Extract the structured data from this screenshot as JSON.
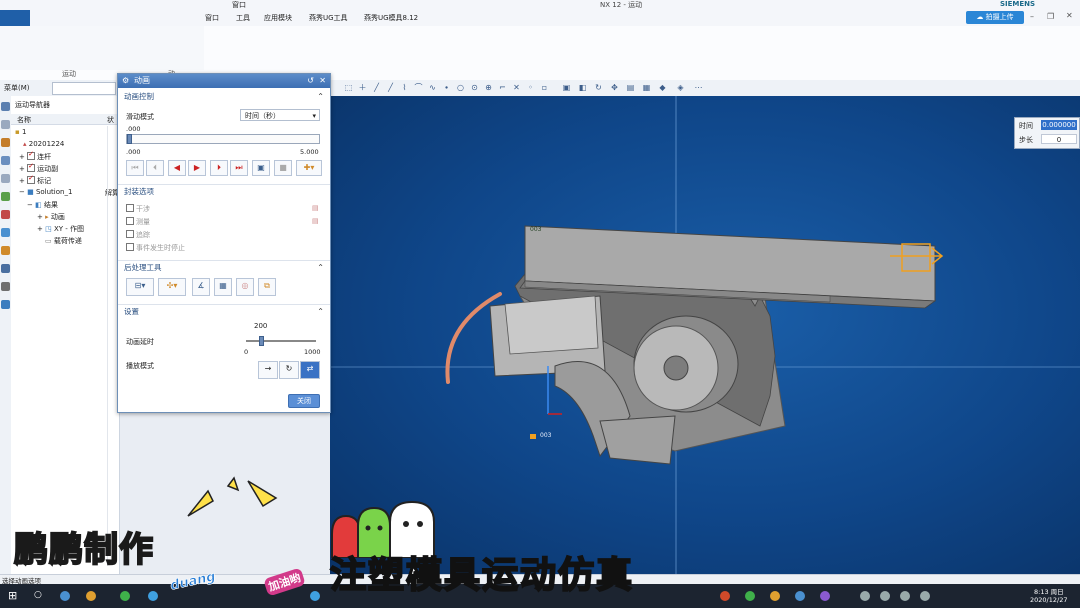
{
  "window": {
    "title": "NX 12 - 运动",
    "brand": "SIEMENS",
    "window_menu": "窗口"
  },
  "menu": {
    "items": [
      "窗口",
      "工具",
      "应用模块",
      "燕秀UG工具",
      "燕秀UG模具8.12"
    ]
  },
  "ribbon": {
    "group_labels": [
      "运动",
      "动"
    ],
    "upload_button": "拍摄上传"
  },
  "toolbar": {
    "view_dropdown": "菜单(M)"
  },
  "navigator": {
    "title": "运动导航器",
    "col_name": "名称",
    "col_status": "状",
    "rows": [
      {
        "label": "1",
        "checked": false
      },
      {
        "label": "20201224",
        "checked": false
      },
      {
        "label": "连杆",
        "checked": true
      },
      {
        "label": "运动副",
        "checked": true
      },
      {
        "label": "标记",
        "checked": true
      },
      {
        "label": "Solution_1",
        "checked": false
      },
      {
        "label": "结果",
        "checked": false
      },
      {
        "label": "动画",
        "checked": false
      },
      {
        "label": "XY - 作图",
        "checked": false
      },
      {
        "label": "载荷传递",
        "checked": false
      }
    ],
    "side_label": "解算"
  },
  "dialog": {
    "title": "动画",
    "section_playback": "动画控制",
    "mode_label": "滑动模式",
    "mode_value": "时间（秒）",
    "slider_value": ".000",
    "range_min": ".000",
    "range_max": "5.000",
    "section_envelope": "封装选项",
    "opt1": "干涉",
    "opt2": "测量",
    "opt3": "追踪",
    "opt4": "事件发生时停止",
    "section_post": "后处理工具",
    "section_settings": "设置",
    "speed_label": "动画延时",
    "speed_value": "200",
    "speed_min": "0",
    "speed_max": "1000",
    "playback_label": "播放模式",
    "close_button": "关闭",
    "slider_fraction": 0.0,
    "speed_fraction": 0.2
  },
  "time_panel": {
    "time_label": "时间",
    "time_value": "0.000000",
    "step_label": "步长",
    "step_value": "0"
  },
  "viewport": {
    "marker_a": "003",
    "marker_b": "003"
  },
  "status_text": "选择动画选项",
  "taskbar": {
    "clock": "8:13 周日",
    "date": "2020/12/27"
  },
  "overlay": {
    "left_caption": "鹏鹏制作",
    "right_caption": "注塑模具运动仿真",
    "sticker": "加油哟",
    "duang": "duang"
  },
  "colors": {
    "viewport_bg": "#0f4689",
    "dialog_title": "#3d6fb3",
    "part_gray": "#9a9a9a",
    "highlight_orange": "#f0a020"
  }
}
